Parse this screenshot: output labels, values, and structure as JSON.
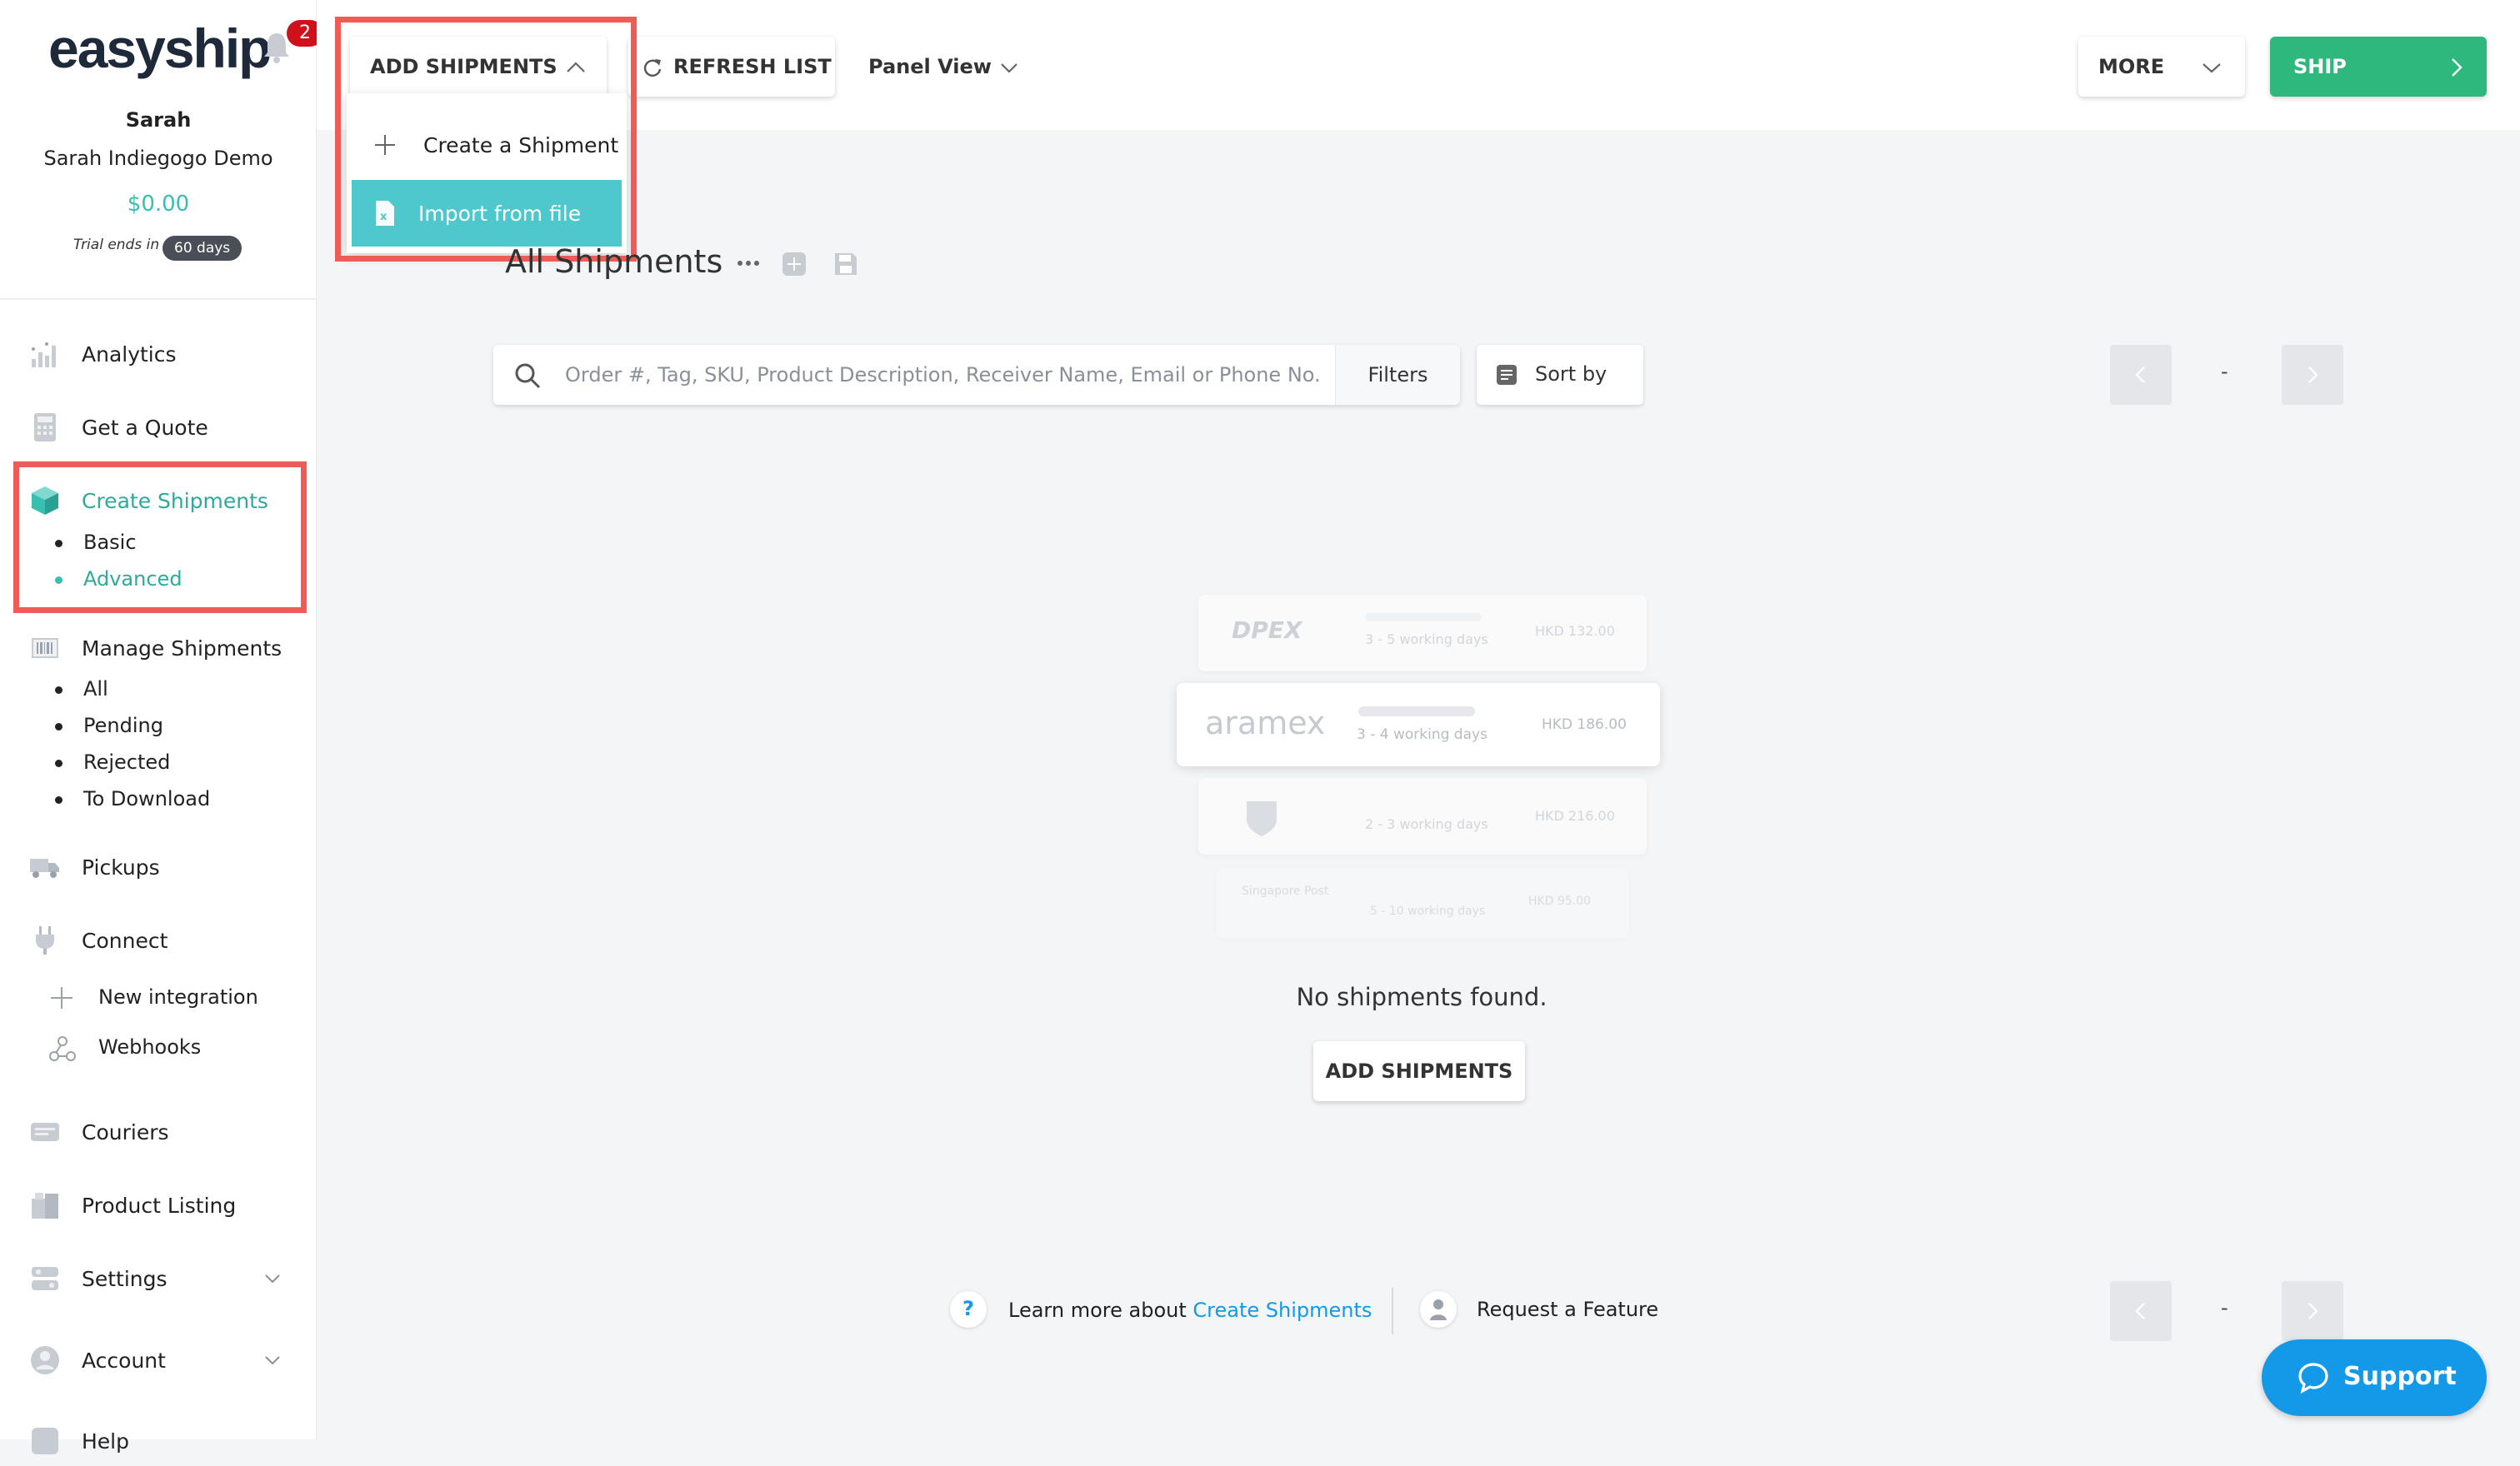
{
  "brand": {
    "logo": "easyship",
    "notifications": "2"
  },
  "user": {
    "name": "Sarah",
    "company": "Sarah Indiegogo Demo",
    "balance": "$0.00",
    "trial_text": "Trial ends in",
    "trial_days": "60 days"
  },
  "sidebar": {
    "analytics": "Analytics",
    "quote": "Get a Quote",
    "create": "Create Shipments",
    "create_sub": [
      "Basic",
      "Advanced"
    ],
    "manage": "Manage Shipments",
    "manage_sub": [
      "All",
      "Pending",
      "Rejected",
      "To Download"
    ],
    "pickups": "Pickups",
    "connect": "Connect",
    "connect_sub": [
      "New integration",
      "Webhooks"
    ],
    "couriers": "Couriers",
    "product_listing": "Product Listing",
    "settings": "Settings",
    "account": "Account",
    "help": "Help"
  },
  "toolbar": {
    "add_shipments": "ADD SHIPMENTS",
    "refresh": "REFRESH LIST",
    "panel_view": "Panel View",
    "more": "MORE",
    "ship": "SHIP"
  },
  "dropdown": {
    "create": "Create a Shipment",
    "import": "Import from file"
  },
  "main": {
    "title": "All Shipments",
    "search_placeholder": "Order #, Tag, SKU, Product Description, Receiver Name, Email or Phone No.",
    "filters": "Filters",
    "sort_by": "Sort by",
    "pager_dash": "-",
    "empty": "No shipments found.",
    "empty_button": "ADD SHIPMENTS"
  },
  "illustration": [
    {
      "courier": "DPEX",
      "days": "3 - 5 working days",
      "price": "HKD 132.00"
    },
    {
      "courier": "aramex",
      "days": "3 - 4 working days",
      "price": "HKD 186.00"
    },
    {
      "courier": "UPS",
      "days": "2 - 3 working days",
      "price": "HKD 216.00"
    },
    {
      "courier": "Singapore Post",
      "days": "5 - 10 working days",
      "price": "HKD 95.00"
    }
  ],
  "footer": {
    "learn_prefix": "Learn more about",
    "learn_link": "Create Shipments",
    "request": "Request a Feature",
    "pager_dash": "-"
  },
  "support": {
    "label": "Support"
  },
  "colors": {
    "teal": "#39bfb0",
    "highlight": "#ef5b57",
    "ship_green": "#2eb87e",
    "support_blue": "#1499e8",
    "badge_red": "#d0111b"
  }
}
